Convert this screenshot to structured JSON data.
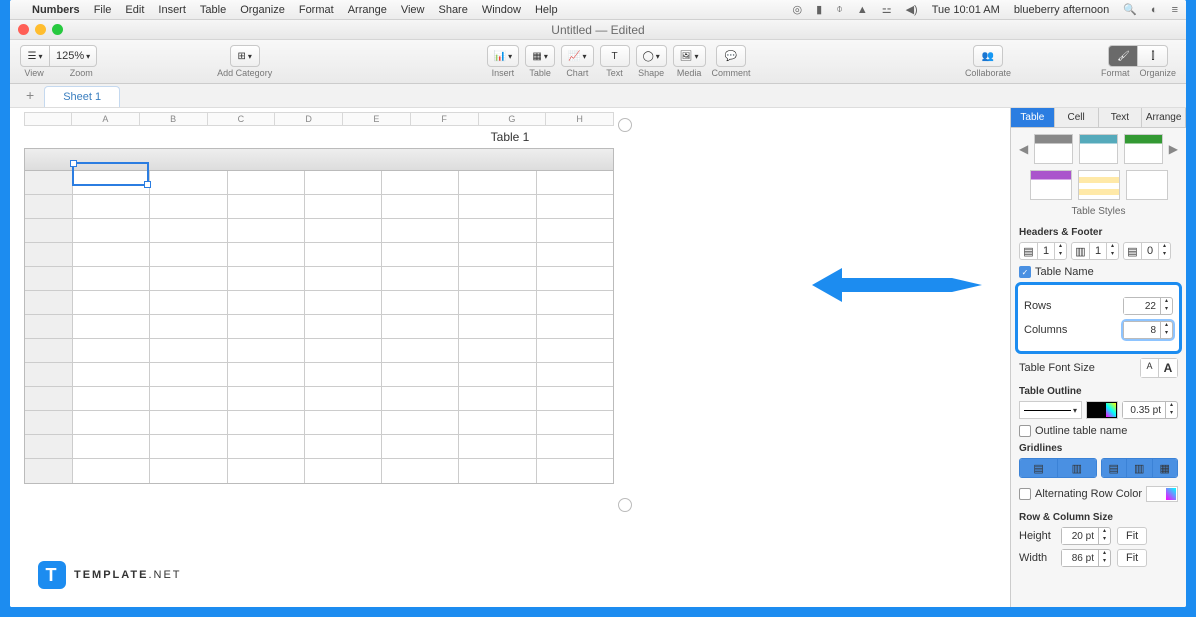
{
  "menubar": {
    "app": "Numbers",
    "items": [
      "File",
      "Edit",
      "Insert",
      "Table",
      "Organize",
      "Format",
      "Arrange",
      "View",
      "Share",
      "Window",
      "Help"
    ],
    "clock": "Tue 10:01 AM",
    "user": "blueberry afternoon"
  },
  "window": {
    "title": "Untitled — Edited"
  },
  "toolbar": {
    "view": "View",
    "zoom": "Zoom",
    "zoom_value": "125%",
    "add_category": "Add Category",
    "insert": "Insert",
    "table": "Table",
    "chart": "Chart",
    "text": "Text",
    "shape": "Shape",
    "media": "Media",
    "comment": "Comment",
    "collaborate": "Collaborate",
    "format": "Format",
    "organize": "Organize"
  },
  "sheets": {
    "tab1": "Sheet 1",
    "add": "+"
  },
  "canvas": {
    "columns": [
      "A",
      "B",
      "C",
      "D",
      "E",
      "F",
      "G",
      "H"
    ],
    "table_title": "Table 1"
  },
  "inspector": {
    "top": {
      "format": "Format",
      "organize": "Organize"
    },
    "tabs": {
      "table": "Table",
      "cell": "Cell",
      "text": "Text",
      "arrange": "Arrange"
    },
    "styles_caption": "Table Styles",
    "headers_footer": "Headers & Footer",
    "hf": {
      "hrow": "1",
      "hcol": "1",
      "frow": "0"
    },
    "table_name": "Table Name",
    "rows_label": "Rows",
    "rows_value": "22",
    "cols_label": "Columns",
    "cols_value": "8",
    "font_size": "Table Font Size",
    "outline": "Table Outline",
    "outline_width": "0.35 pt",
    "outline_tn": "Outline table name",
    "gridlines": "Gridlines",
    "alt_row": "Alternating Row Color",
    "rcs": "Row & Column Size",
    "height": "Height",
    "height_v": "20 pt",
    "width": "Width",
    "width_v": "86 pt",
    "fit": "Fit"
  },
  "logo": {
    "text": "TEMPLATE",
    "suffix": ".NET"
  }
}
